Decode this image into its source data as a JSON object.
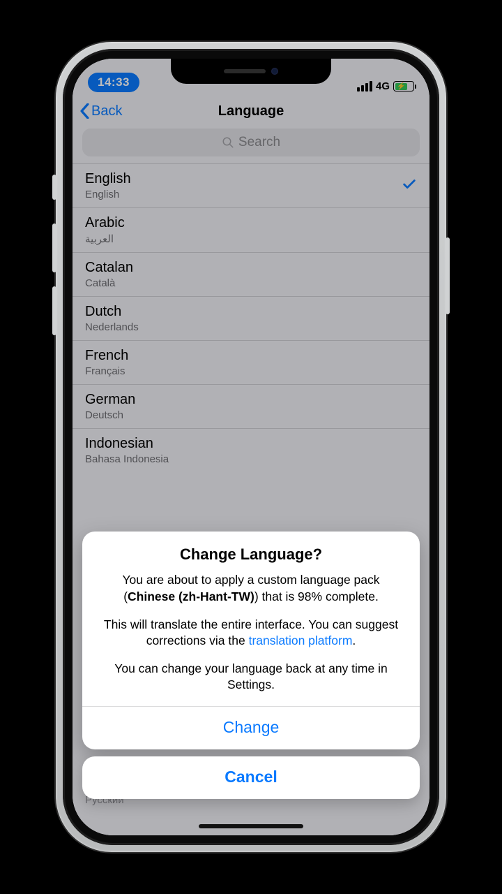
{
  "status": {
    "time": "14:33",
    "network": "4G"
  },
  "nav": {
    "back": "Back",
    "title": "Language"
  },
  "search": {
    "placeholder": "Search"
  },
  "languages": [
    {
      "name": "English",
      "native": "English",
      "selected": true
    },
    {
      "name": "Arabic",
      "native": "العربية",
      "selected": false
    },
    {
      "name": "Catalan",
      "native": "Català",
      "selected": false
    },
    {
      "name": "Dutch",
      "native": "Nederlands",
      "selected": false
    },
    {
      "name": "French",
      "native": "Français",
      "selected": false
    },
    {
      "name": "German",
      "native": "Deutsch",
      "selected": false
    },
    {
      "name": "Indonesian",
      "native": "Bahasa Indonesia",
      "selected": false
    }
  ],
  "ghost": {
    "russian": "Русский"
  },
  "alert": {
    "title": "Change Language?",
    "p1_a": "You are about to apply a custom language pack (",
    "p1_bold": "Chinese (zh-Hant-TW)",
    "p1_b": ") that is 98% complete.",
    "p2_a": "This will translate the entire interface. You can suggest corrections via the ",
    "p2_link": "translation platform",
    "p2_b": ".",
    "p3": "You can change your language back at any time in Settings.",
    "change": "Change",
    "cancel": "Cancel"
  }
}
